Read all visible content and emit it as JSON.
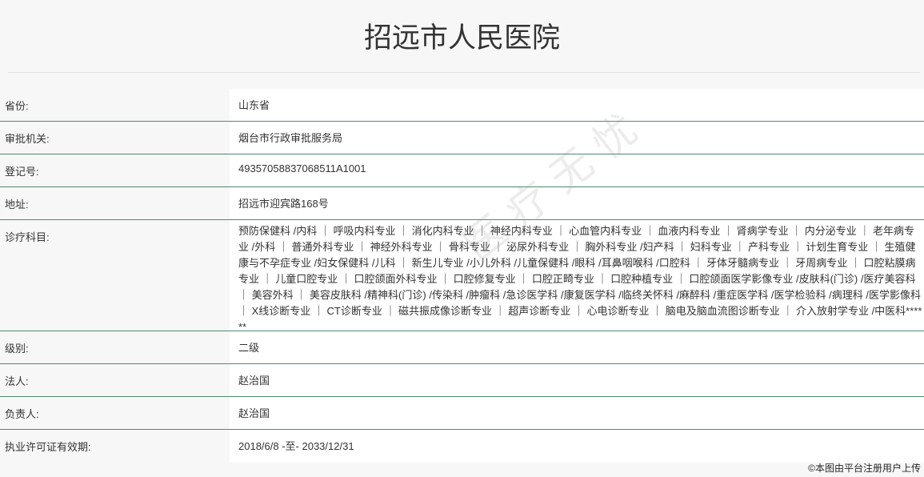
{
  "page": {
    "title": "招远市人民医院",
    "credit": "©本图由平台注册用户上传"
  },
  "colors": {
    "row_divider": "#4e8b6c",
    "label_bg": "#f7f7f7",
    "value_bg": "#ffffff"
  },
  "rows": [
    {
      "label": "省份:",
      "value": "山东省"
    },
    {
      "label": "审批机关:",
      "value": "烟台市行政审批服务局"
    },
    {
      "label": "登记号:",
      "value": "49357058837068511A1001"
    },
    {
      "label": "地址:",
      "value": "招远市迎宾路168号"
    },
    {
      "label": "诊疗科目:",
      "value": "预防保健科 /内科 ｜ 呼吸内科专业 ｜ 消化内科专业 ｜ 神经内科专业 ｜ 心血管内科专业 ｜ 血液内科专业 ｜ 肾病学专业 ｜ 内分泌专业 ｜ 老年病专业 /外科 ｜ 普通外科专业 ｜ 神经外科专业 ｜ 骨科专业 ｜ 泌尿外科专业 ｜ 胸外科专业 /妇产科 ｜ 妇科专业 ｜ 产科专业 ｜ 计划生育专业 ｜ 生殖健康与不孕症专业 /妇女保健科 /儿科 ｜ 新生儿专业 /小儿外科 /儿童保健科 /眼科 /耳鼻咽喉科 /口腔科 ｜ 牙体牙髓病专业 ｜ 牙周病专业 ｜ 口腔粘膜病专业 ｜ 儿童口腔专业 ｜ 口腔颌面外科专业 ｜ 口腔修复专业 ｜ 口腔正畸专业 ｜ 口腔种植专业 ｜ 口腔颌面医学影像专业 /皮肤科(门诊) /医疗美容科 ｜ 美容外科 ｜ 美容皮肤科 /精神科(门诊) /传染科 /肿瘤科 /急诊医学科 /康复医学科 /临终关怀科 /麻醉科 /重症医学科 /医学检验科 /病理科 /医学影像科 ｜ X线诊断专业 ｜ CT诊断专业 ｜ 磁共振成像诊断专业 ｜ 超声诊断专业 ｜ 心电诊断专业 ｜ 脑电及脑血流图诊断专业 ｜ 介入放射学专业 /中医科******"
    },
    {
      "label": "级别:",
      "value": "二级"
    },
    {
      "label": "法人:",
      "value": "赵治国"
    },
    {
      "label": "负责人:",
      "value": "赵治国"
    },
    {
      "label": "执业许可证有效期:",
      "value": "2018/6/8 -至- 2033/12/31"
    }
  ]
}
